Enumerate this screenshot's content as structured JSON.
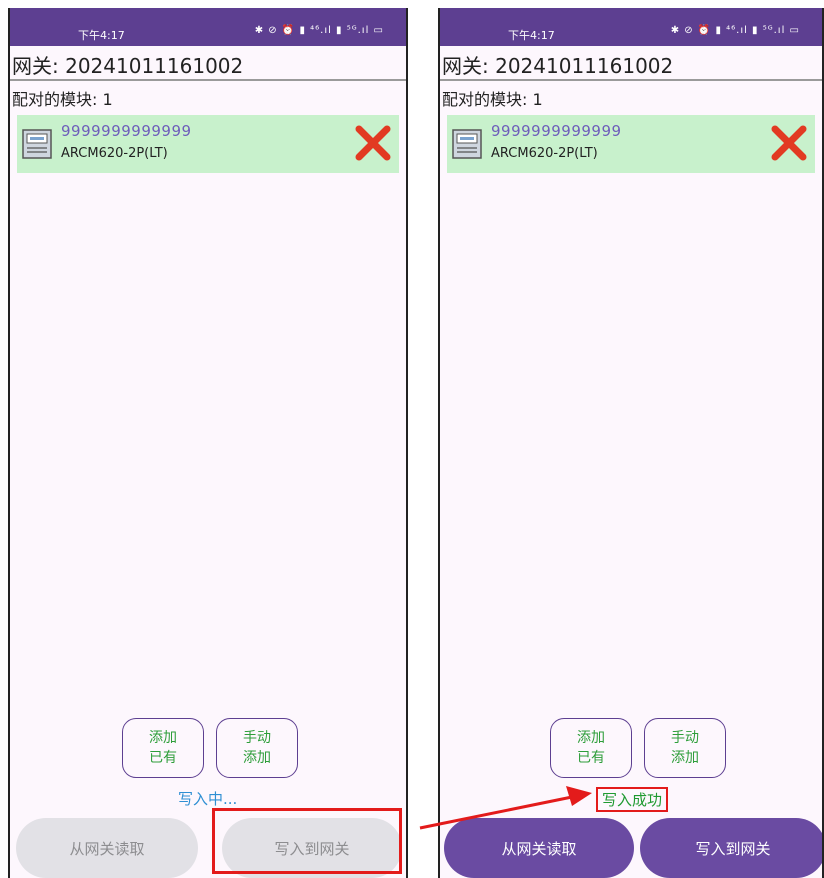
{
  "left_screen": {
    "status_bar": {
      "time": "下午4:17",
      "icons": "✱ ⊘ ⏰ ▮ ⁴⁶.ıl ▮ ⁵ᴳ.ıl ▭"
    },
    "gateway_label": "网关: 20241011161002",
    "paired_label": "配对的模块: 1",
    "module": {
      "id": "9999999999999",
      "model": "ARCM620-2P(LT)"
    },
    "add_existing_label": "添加\n已有",
    "manual_add_label": "手动\n添加",
    "status_text": "写入中...",
    "read_button_label": "从网关读取",
    "write_button_label": "写入到网关"
  },
  "right_screen": {
    "status_bar": {
      "time": "下午4:17",
      "icons": "✱ ⊘ ⏰ ▮ ⁴⁶.ıl ▮ ⁵ᴳ.ıl ▭"
    },
    "gateway_label": "网关: 20241011161002",
    "paired_label": "配对的模块: 1",
    "module": {
      "id": "9999999999999",
      "model": "ARCM620-2P(LT)"
    },
    "add_existing_label": "添加\n已有",
    "manual_add_label": "手动\n添加",
    "status_text": "写入成功",
    "read_button_label": "从网关读取",
    "write_button_label": "写入到网关"
  },
  "colors": {
    "status_bar": "#5d3f91",
    "module_card": "#c8f1cc",
    "delete_icon": "#e23a22",
    "highlight": "#e31b1b",
    "button_enabled": "#6a4ba2",
    "button_disabled": "#e2e1e6"
  }
}
